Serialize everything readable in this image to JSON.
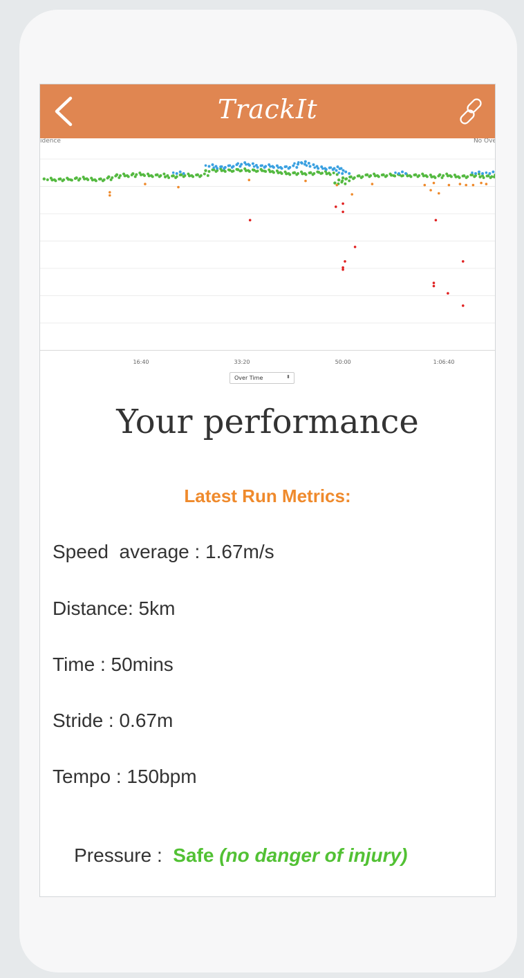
{
  "app": {
    "title": "TrackIt",
    "back_icon": "chevron-left-icon",
    "link_icon": "link-icon",
    "brand_color": "#e08651"
  },
  "chart_data": {
    "type": "scatter",
    "x_tick_labels": [
      "16:40",
      "33:20",
      "50:00",
      "1:06:40"
    ],
    "x_tick_values": [
      1000,
      2000,
      3000,
      4000
    ],
    "xlim": [
      0,
      4520
    ],
    "ylim": [
      0,
      10
    ],
    "corner_label_left": "ıdence",
    "corner_label_right": "No Ove",
    "series": [
      {
        "color": "#54b940",
        "points": [
          [
            40,
            8.3
          ],
          [
            120,
            8.25
          ],
          [
            200,
            8.3
          ],
          [
            280,
            8.28
          ],
          [
            360,
            8.35
          ],
          [
            440,
            8.3
          ],
          [
            520,
            8.25
          ],
          [
            600,
            8.3
          ],
          [
            680,
            8.4
          ],
          [
            760,
            8.5
          ],
          [
            840,
            8.45
          ],
          [
            920,
            8.55
          ],
          [
            1000,
            8.5
          ],
          [
            1080,
            8.45
          ],
          [
            1160,
            8.5
          ],
          [
            1240,
            8.4
          ],
          [
            1320,
            8.45
          ],
          [
            1400,
            8.5
          ],
          [
            1480,
            8.45
          ],
          [
            1560,
            8.5
          ],
          [
            1640,
            8.7
          ],
          [
            1720,
            8.75
          ],
          [
            1800,
            8.7
          ],
          [
            1880,
            8.72
          ],
          [
            1960,
            8.75
          ],
          [
            2040,
            8.7
          ],
          [
            2120,
            8.72
          ],
          [
            2200,
            8.7
          ],
          [
            2280,
            8.65
          ],
          [
            2360,
            8.6
          ],
          [
            2440,
            8.55
          ],
          [
            2520,
            8.6
          ],
          [
            2600,
            8.55
          ],
          [
            2680,
            8.6
          ],
          [
            2760,
            8.62
          ],
          [
            2840,
            8.55
          ],
          [
            2920,
            8.1
          ],
          [
            2960,
            8.25
          ],
          [
            3000,
            8.35
          ],
          [
            3080,
            8.4
          ],
          [
            3160,
            8.45
          ],
          [
            3240,
            8.5
          ],
          [
            3320,
            8.45
          ],
          [
            3400,
            8.5
          ],
          [
            3480,
            8.48
          ],
          [
            3560,
            8.5
          ],
          [
            3640,
            8.45
          ],
          [
            3720,
            8.5
          ],
          [
            3800,
            8.45
          ],
          [
            3880,
            8.4
          ],
          [
            3960,
            8.5
          ],
          [
            4040,
            8.45
          ],
          [
            4120,
            8.4
          ],
          [
            4200,
            8.45
          ],
          [
            4280,
            8.5
          ],
          [
            4360,
            8.4
          ],
          [
            4440,
            8.45
          ],
          [
            4500,
            8.4
          ]
        ]
      },
      {
        "color": "#3aa0e0",
        "points": [
          [
            1320,
            8.6
          ],
          [
            1640,
            8.95
          ],
          [
            1720,
            8.85
          ],
          [
            1800,
            8.9
          ],
          [
            1880,
            8.95
          ],
          [
            1960,
            9.05
          ],
          [
            2040,
            9.0
          ],
          [
            2120,
            8.9
          ],
          [
            2200,
            8.95
          ],
          [
            2280,
            8.9
          ],
          [
            2360,
            8.85
          ],
          [
            2440,
            8.9
          ],
          [
            2520,
            9.05
          ],
          [
            2560,
            9.1
          ],
          [
            2640,
            8.95
          ],
          [
            2720,
            8.85
          ],
          [
            2800,
            8.8
          ],
          [
            2880,
            8.85
          ],
          [
            2900,
            8.75
          ],
          [
            2960,
            8.6
          ],
          [
            3520,
            8.6
          ],
          [
            4280,
            8.6
          ],
          [
            4420,
            8.6
          ]
        ]
      },
      {
        "color": "#ef8a2c",
        "points": [
          [
            690,
            7.65
          ],
          [
            690,
            7.5
          ],
          [
            1040,
            8.05
          ],
          [
            1370,
            7.9
          ],
          [
            2070,
            8.25
          ],
          [
            2630,
            8.2
          ],
          [
            2940,
            8.0
          ],
          [
            3090,
            7.55
          ],
          [
            3290,
            8.05
          ],
          [
            3810,
            8.0
          ],
          [
            3870,
            7.75
          ],
          [
            3900,
            8.1
          ],
          [
            3950,
            7.6
          ],
          [
            4050,
            8.0
          ],
          [
            4160,
            8.05
          ],
          [
            4220,
            8.0
          ],
          [
            4290,
            8.0
          ],
          [
            4370,
            8.1
          ],
          [
            4420,
            8.05
          ]
        ]
      },
      {
        "color": "#e02020",
        "points": [
          [
            2080,
            6.3
          ],
          [
            2930,
            6.95
          ],
          [
            3000,
            7.1
          ],
          [
            3000,
            6.7
          ],
          [
            3120,
            5.0
          ],
          [
            3000,
            4.0
          ],
          [
            3020,
            4.3
          ],
          [
            3000,
            3.9
          ],
          [
            3900,
            3.25
          ],
          [
            3900,
            3.1
          ],
          [
            3920,
            6.3
          ],
          [
            4040,
            2.75
          ],
          [
            4190,
            4.3
          ],
          [
            4190,
            2.15
          ]
        ]
      }
    ]
  },
  "chart_control": {
    "selected": "Over Time",
    "arrows": "⬍"
  },
  "performance": {
    "title": "Your performance",
    "heading": "Latest Run Metrics:",
    "speed": "Speed  average : 1.67m/s",
    "distance": "Distance: 5km",
    "time": "Time : 50mins",
    "stride": "Stride : 0.67m",
    "tempo": "Tempo : 150bpm",
    "pressure_label": "Pressure :  ",
    "pressure_value_safe": "Safe ",
    "pressure_value_note": "(no danger of injury)",
    "pressure_color": "#52c134",
    "heading_color": "#ef8a2c"
  }
}
